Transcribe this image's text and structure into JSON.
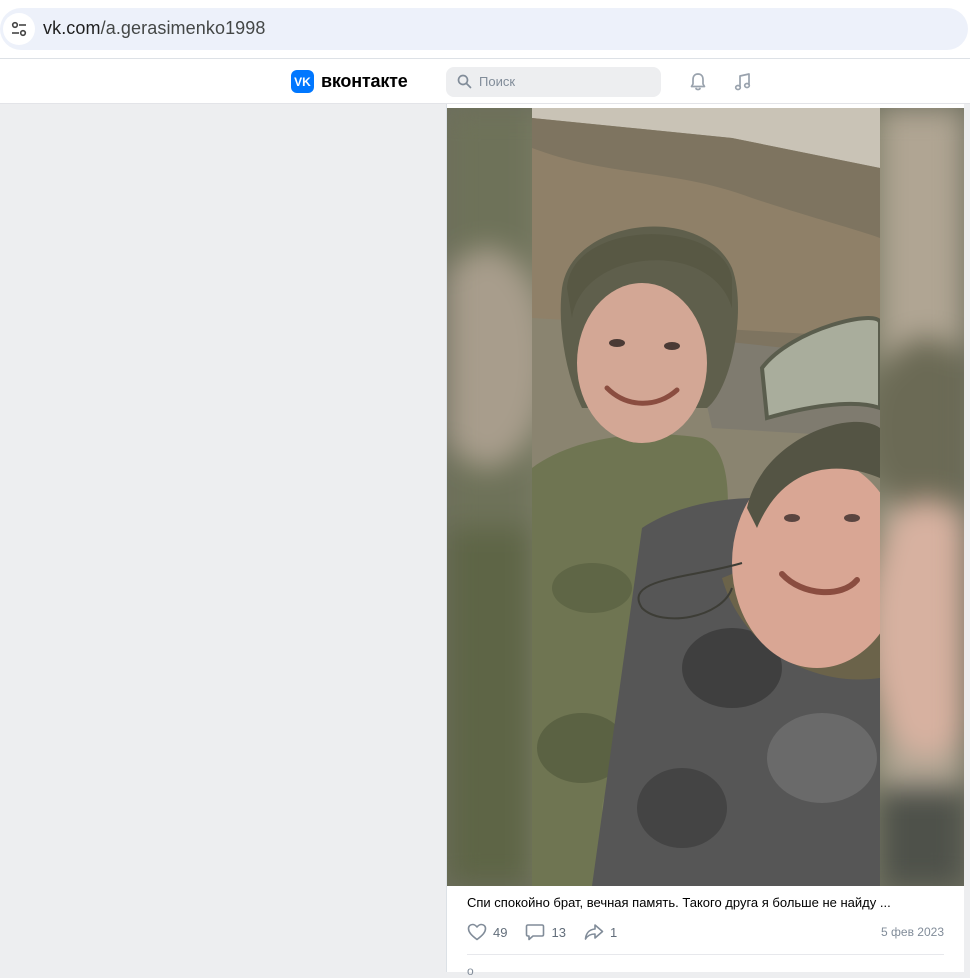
{
  "browser": {
    "url_host": "vk.com",
    "url_path": "/a.gerasimenko1998"
  },
  "header": {
    "logo_text": "вконтакте",
    "logo_mark": "VK",
    "search_placeholder": "Поиск",
    "icons": [
      "search-icon",
      "bell-icon",
      "music-icon"
    ],
    "accent_color": "#0077ff"
  },
  "post": {
    "text": "Спи спокойно брат, вечная память. Такого друга я больше не найду ...",
    "likes": "49",
    "comments": "13",
    "shares": "1",
    "date": "5 фев 2023",
    "more": "о"
  }
}
